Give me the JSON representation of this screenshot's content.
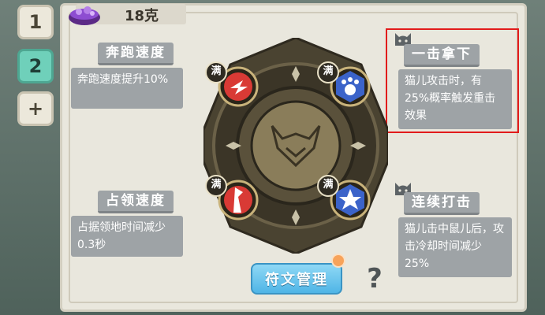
{
  "tabs": [
    {
      "label": "1",
      "active": false
    },
    {
      "label": "2",
      "active": true
    },
    {
      "label": "+",
      "active": false
    }
  ],
  "currency": {
    "amount": "18克",
    "icon": "purple-gem-bowl-icon"
  },
  "skills": {
    "run_speed": {
      "title": "奔跑速度",
      "desc": "奔跑速度提升10%"
    },
    "capture_speed": {
      "title": "占领速度",
      "desc": "占据领地时间减少0.3秒"
    },
    "one_hit": {
      "title": "一击拿下",
      "desc": "猫儿攻击时，有25%概率触发重击效果"
    },
    "combo": {
      "title": "连续打击",
      "desc": "猫儿击中鼠儿后，攻击冷却时间减少25%"
    }
  },
  "wheel": {
    "slots": [
      {
        "badge": "满",
        "icon": "red-fox-dash-icon"
      },
      {
        "badge": "满",
        "icon": "blue-paw-icon"
      },
      {
        "badge": "满",
        "icon": "red-flag-icon"
      },
      {
        "badge": "满",
        "icon": "blue-star-burst-icon"
      }
    ],
    "center_icon": "horned-emblem-icon"
  },
  "buttons": {
    "rune_manage": "符文管理",
    "help": "?"
  },
  "colors": {
    "highlight": "#e21b1b",
    "active_tab": "#6fd0ba",
    "button": "#4fb5e6"
  }
}
